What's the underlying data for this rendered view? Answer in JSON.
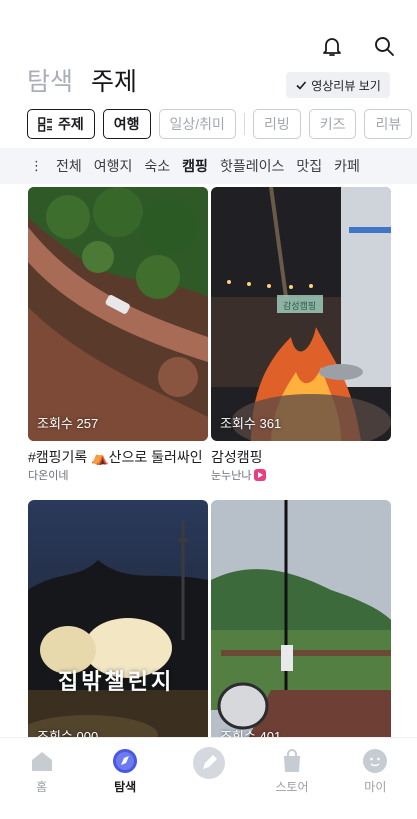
{
  "header": {
    "tabs": [
      {
        "label": "탐색",
        "active": false
      },
      {
        "label": "주제",
        "active": true
      }
    ],
    "review_button": "영상리뷰 보기"
  },
  "chips": [
    {
      "label": "주제",
      "style": "bold",
      "icon": "grid-icon"
    },
    {
      "label": "여행",
      "style": "bold"
    },
    {
      "label": "일상/취미",
      "style": "light"
    },
    {
      "label": "리빙",
      "style": "light"
    },
    {
      "label": "키즈",
      "style": "light"
    },
    {
      "label": "리뷰",
      "style": "light"
    }
  ],
  "subcategories": {
    "more": "⋮",
    "items": [
      {
        "label": "전체",
        "active": false
      },
      {
        "label": "여행지",
        "active": false
      },
      {
        "label": "숙소",
        "active": false
      },
      {
        "label": "캠핑",
        "active": true
      },
      {
        "label": "핫플레이스",
        "active": false
      },
      {
        "label": "맛집",
        "active": false
      },
      {
        "label": "카페",
        "active": false
      }
    ]
  },
  "posts": [
    {
      "views": "조회수 257",
      "title": "#캠핑기록 ⛺산으로 둘러싸인",
      "author": "다온이네",
      "badge": false,
      "overlay_text": ""
    },
    {
      "views": "조회수 361",
      "title": "감성캠핑",
      "author": "눈누난나",
      "badge": true,
      "overlay_text": "감성캠핑"
    },
    {
      "views": "조회수 000",
      "title": "",
      "author": "",
      "badge": false,
      "overlay_text": "집밖챌린지"
    },
    {
      "views": "조회수 401",
      "title": "",
      "author": "",
      "badge": false,
      "overlay_text": ""
    }
  ],
  "bottom_nav": [
    {
      "label": "홈",
      "icon": "home-icon",
      "active": false
    },
    {
      "label": "탐색",
      "icon": "explore-icon",
      "active": true
    },
    {
      "label": "",
      "icon": "write-icon",
      "active": false
    },
    {
      "label": "스토어",
      "icon": "store-bag-icon",
      "active": false
    },
    {
      "label": "마이",
      "icon": "profile-icon",
      "active": false
    }
  ],
  "colors": {
    "accent_pink": "#e83f83",
    "explore_blue": "#4a57e3",
    "inactive_gray": "#a9aeb8"
  }
}
